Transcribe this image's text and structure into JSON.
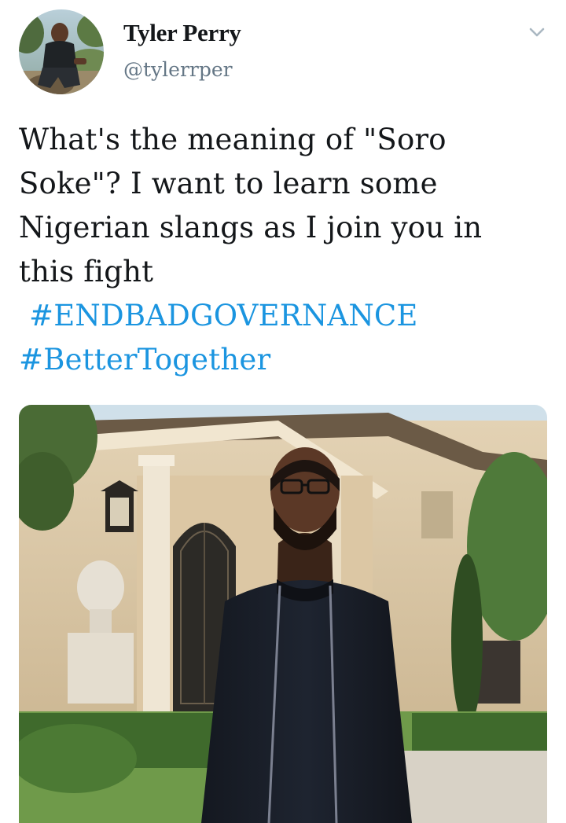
{
  "author": {
    "name": "Tyler Perry",
    "handle": "@tylerrper",
    "avatar_icon": "profile-photo"
  },
  "menu": {
    "icon": "chevron-down-icon"
  },
  "tweet": {
    "text_lines": [
      "What's the meaning of \"Soro",
      "Soke\"? I want to learn some",
      "Nigerian slangs as I join you in",
      "this fight"
    ],
    "hashtags": [
      "#ENDBADGOVERNANCE",
      "#BetterTogether"
    ]
  },
  "media": {
    "icon": "photo-attachment"
  },
  "colors": {
    "text": "#14171a",
    "secondary": "#657786",
    "link": "#1b95e0",
    "background": "#ffffff"
  }
}
